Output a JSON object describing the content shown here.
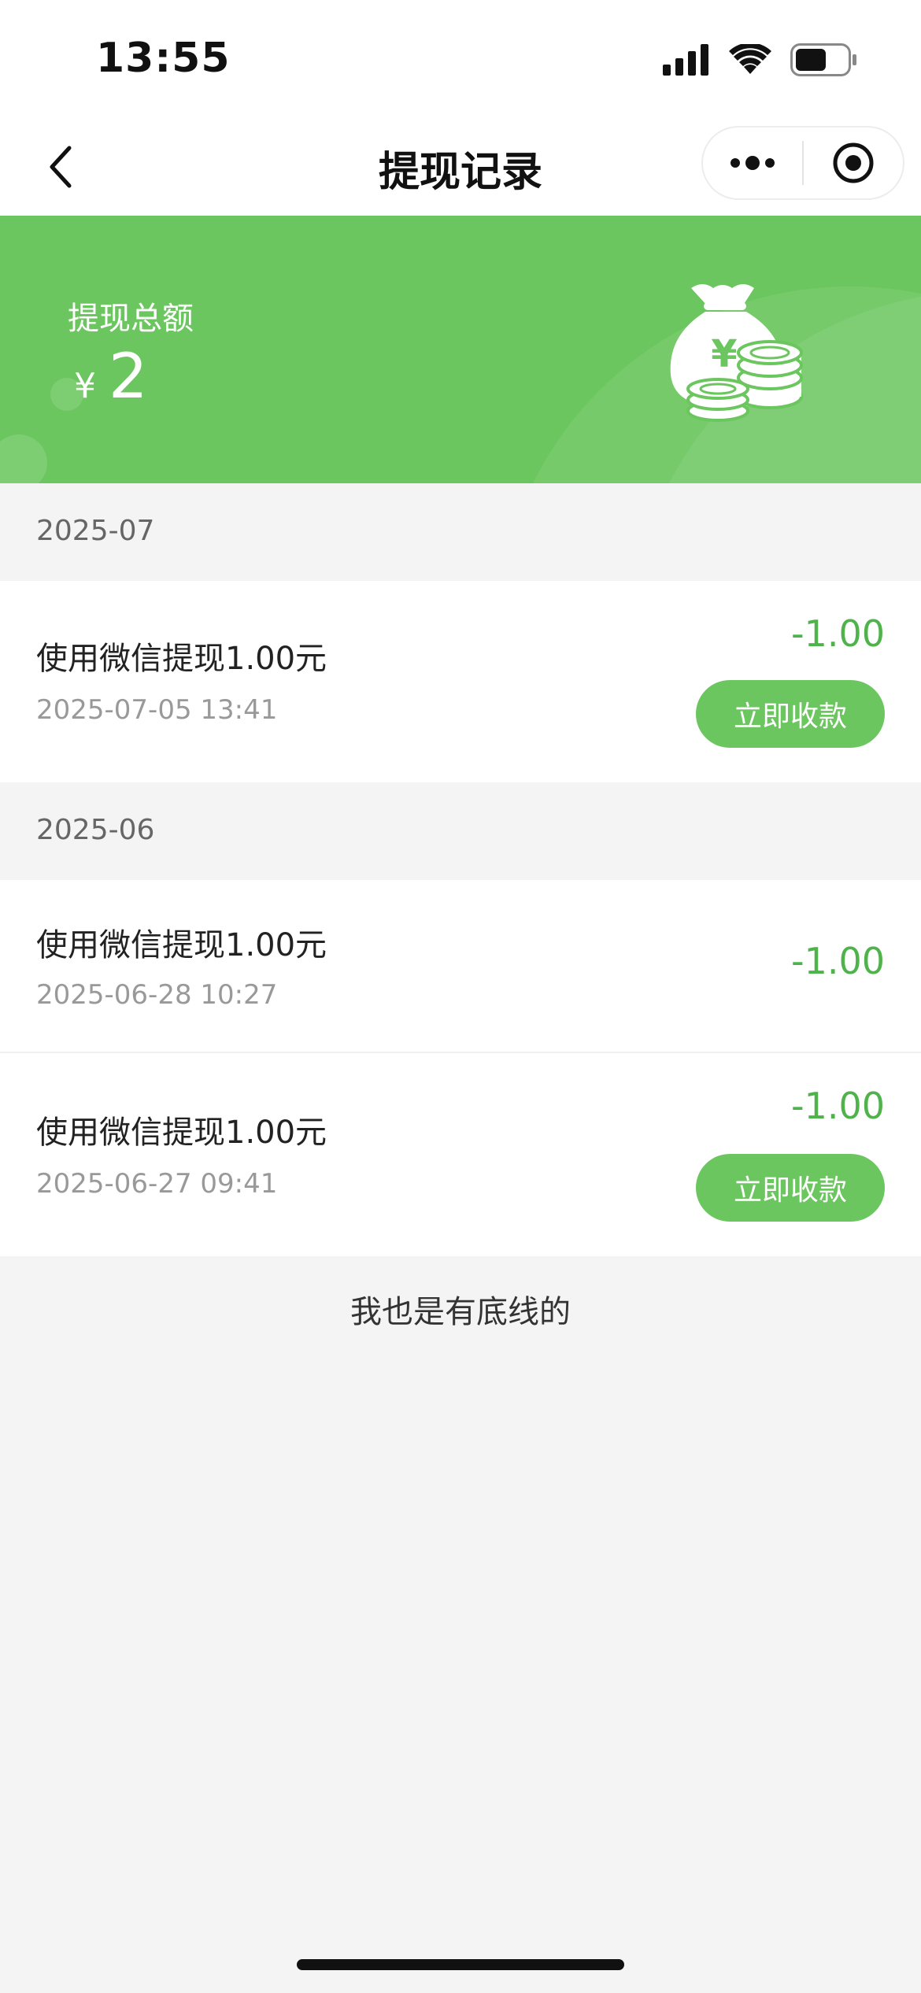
{
  "status_bar": {
    "time": "13:55",
    "icons": [
      "signal-icon",
      "wifi-icon",
      "battery-icon"
    ],
    "battery_level_percent": 60
  },
  "nav": {
    "title": "提现记录",
    "back_icon": "chevron-left-icon",
    "capsule_icons": [
      "more-dots-icon",
      "record-target-icon"
    ]
  },
  "banner": {
    "label": "提现总额",
    "currency": "¥",
    "total": "2",
    "icon": "money-bag-coins-icon",
    "bg_color": "#6cc65f"
  },
  "groups": [
    {
      "month": "2025-07",
      "records": [
        {
          "title": "使用微信提现1.00元",
          "time": "2025-07-05 13:41",
          "amount": "-1.00",
          "action": "立即收款"
        }
      ]
    },
    {
      "month": "2025-06",
      "records": [
        {
          "title": "使用微信提现1.00元",
          "time": "2025-06-28 10:27",
          "amount": "-1.00"
        },
        {
          "title": "使用微信提现1.00元",
          "time": "2025-06-27 09:41",
          "amount": "-1.00",
          "action": "立即收款"
        }
      ]
    }
  ],
  "footer": {
    "text": "我也是有底线的"
  },
  "colors": {
    "accent": "#6cc65f",
    "amount": "#4fb24b",
    "page_bg": "#f4f4f4"
  }
}
